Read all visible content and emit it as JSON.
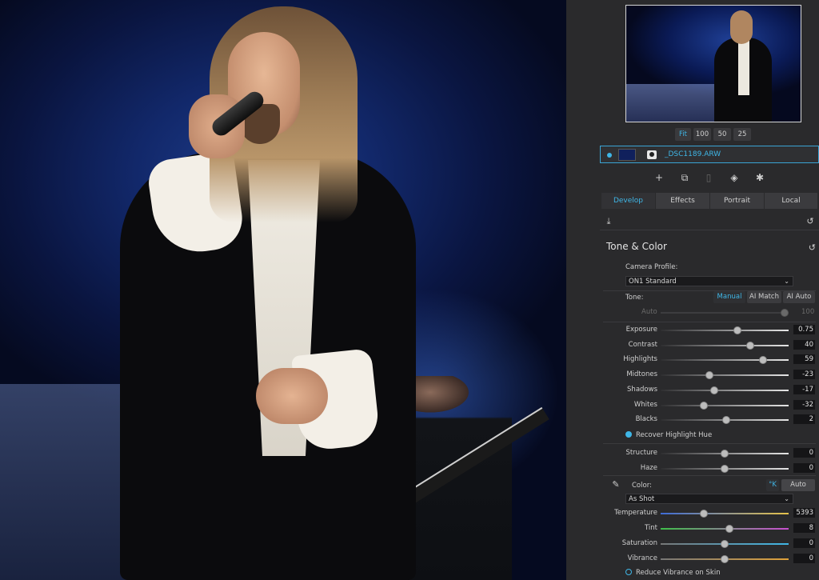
{
  "navigator": {
    "zoom": [
      "Fit",
      "100",
      "50",
      "25"
    ],
    "active_zoom": "Fit"
  },
  "layer": {
    "name": "_DSC1189.ARW"
  },
  "tabs": [
    "Develop",
    "Effects",
    "Portrait",
    "Local"
  ],
  "active_tab": "Develop",
  "tone_color": {
    "title": "Tone & Color",
    "camera_profile_label": "Camera Profile:",
    "camera_profile": "ON1 Standard",
    "tone_label": "Tone:",
    "tone_modes": [
      "Manual",
      "AI Match",
      "AI Auto"
    ],
    "tone_mode_active": "Manual",
    "auto_label": "Auto",
    "auto_value": "100",
    "sliders": [
      {
        "label": "Exposure",
        "value": "0.75",
        "pos": 0.6
      },
      {
        "label": "Contrast",
        "value": "40",
        "pos": 0.7
      },
      {
        "label": "Highlights",
        "value": "59",
        "pos": 0.8
      },
      {
        "label": "Midtones",
        "value": "-23",
        "pos": 0.38
      },
      {
        "label": "Shadows",
        "value": "-17",
        "pos": 0.42
      },
      {
        "label": "Whites",
        "value": "-32",
        "pos": 0.34
      },
      {
        "label": "Blacks",
        "value": "2",
        "pos": 0.51
      }
    ],
    "recover_highlight": "Recover Highlight Hue",
    "sliders2": [
      {
        "label": "Structure",
        "value": "0",
        "pos": 0.5
      },
      {
        "label": "Haze",
        "value": "0",
        "pos": 0.5
      }
    ],
    "color_label": "Color:",
    "color_k": "°K",
    "color_auto": "Auto",
    "white_balance": "As Shot",
    "color_sliders": [
      {
        "label": "Temperature",
        "value": "5393",
        "pos": 0.34,
        "kind": "temp"
      },
      {
        "label": "Tint",
        "value": "8",
        "pos": 0.54,
        "kind": "tint"
      },
      {
        "label": "Saturation",
        "value": "0",
        "pos": 0.5,
        "kind": "sat"
      },
      {
        "label": "Vibrance",
        "value": "0",
        "pos": 0.5,
        "kind": "vib"
      }
    ],
    "reduce_vibrance": "Reduce Vibrance on Skin"
  },
  "colors": {
    "accent": "#3fb6e6",
    "panel": "#2a2a2c"
  }
}
